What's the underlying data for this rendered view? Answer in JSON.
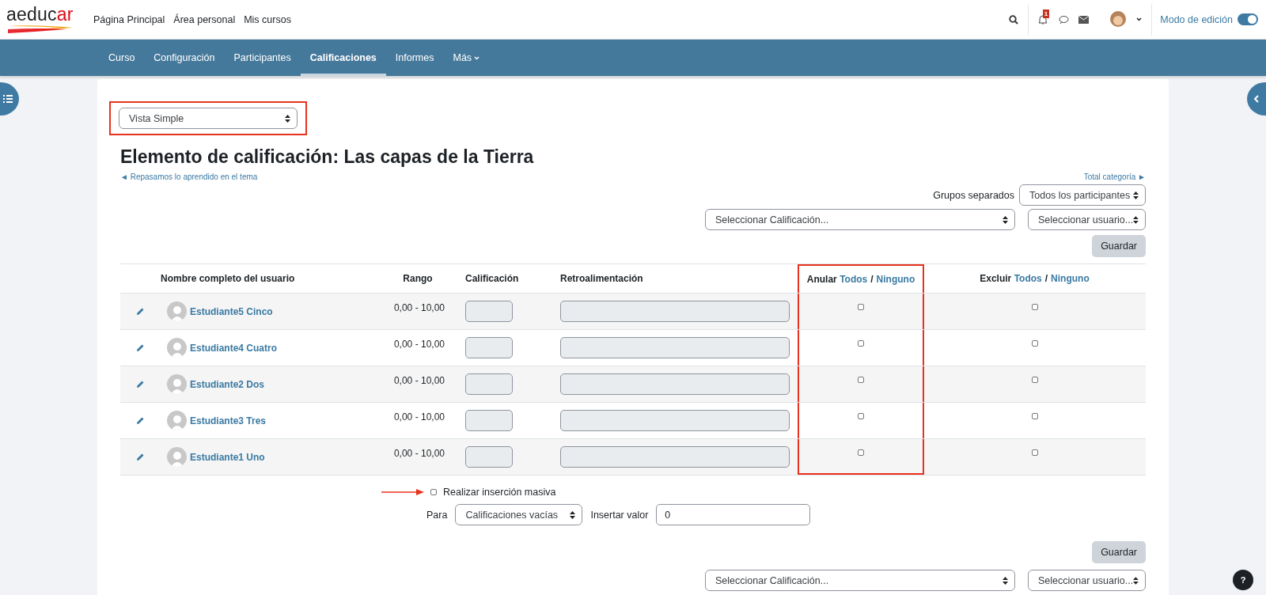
{
  "header": {
    "logo": {
      "main": "aeduc",
      "accent": "ar"
    },
    "links": [
      "Página Principal",
      "Área personal",
      "Mis cursos"
    ],
    "notification_count": "1",
    "edit_mode": {
      "label": "Modo de edición",
      "on": true
    }
  },
  "course_nav": [
    {
      "label": "Curso",
      "selected": false
    },
    {
      "label": "Configuración",
      "selected": false
    },
    {
      "label": "Participantes",
      "selected": false
    },
    {
      "label": "Calificaciones",
      "selected": true
    },
    {
      "label": "Informes",
      "selected": false
    },
    {
      "label": "Más",
      "selected": false,
      "kind": "menu"
    }
  ],
  "view_select": {
    "value": "Vista Simple"
  },
  "title": "Elemento de calificación: Las capas de la Tierra",
  "prev_link": "◄ Repasamos lo aprendido en el tema",
  "next_link": "Total categoría ►",
  "groups": {
    "label": "Grupos separados",
    "value": "Todos los participantes"
  },
  "grade_select": {
    "value": "Seleccionar Calificación..."
  },
  "user_select": {
    "value": "Seleccionar usuario..."
  },
  "save_button": "Guardar",
  "table": {
    "columns": [
      "Nombre completo del usuario",
      "Rango",
      "Calificación",
      "Retroalimentación"
    ],
    "override_header": {
      "label": "Anular",
      "all": "Todos",
      "sep": "/",
      "none": "Ninguno"
    },
    "exclude_header": {
      "label": "Excluir",
      "all": "Todos",
      "sep": "/",
      "none": "Ninguno"
    },
    "rows": [
      {
        "name": "Estudiante5 Cinco",
        "range": "0,00 - 10,00",
        "override": false,
        "exclude": false
      },
      {
        "name": "Estudiante4 Cuatro",
        "range": "0,00 - 10,00",
        "override": false,
        "exclude": false
      },
      {
        "name": "Estudiante2 Dos",
        "range": "0,00 - 10,00",
        "override": false,
        "exclude": false
      },
      {
        "name": "Estudiante3 Tres",
        "range": "0,00 - 10,00",
        "override": false,
        "exclude": false
      },
      {
        "name": "Estudiante1 Uno",
        "range": "0,00 - 10,00",
        "override": false,
        "exclude": false
      }
    ]
  },
  "bulk": {
    "label": "Realizar inserción masiva",
    "checked": false,
    "for_label": "Para",
    "for_value": "Calificaciones vacías",
    "insert_label": "Insertar valor",
    "insert_value": "0"
  },
  "save_button_bottom": "Guardar",
  "grade_select_bottom": {
    "value": "Seleccionar Calificación..."
  },
  "user_select_bottom": {
    "value": "Seleccionar usuario..."
  },
  "help": "?"
}
